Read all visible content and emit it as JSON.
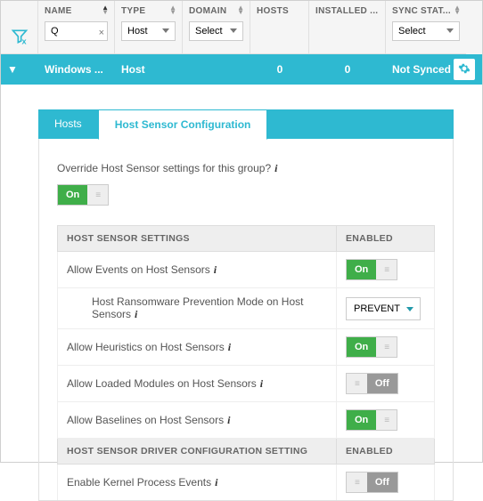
{
  "columns": {
    "name": "NAME",
    "type": "TYPE",
    "domain": "DOMAIN",
    "hosts": "HOSTS",
    "installed": "INSTALLED ...",
    "sync": "SYNC STAT..."
  },
  "filters": {
    "name_value": "Q",
    "type_value": "Host",
    "domain_value": "Select",
    "sync_value": "Select"
  },
  "row": {
    "name": "Windows ...",
    "type": "Host",
    "domain": "",
    "hosts": "0",
    "installed": "0",
    "sync": "Not Synced"
  },
  "tabs": {
    "hosts": "Hosts",
    "config": "Host Sensor Configuration"
  },
  "override_label": "Override Host Sensor settings for this group?",
  "on_label": "On",
  "off_label": "Off",
  "hamburger": "≡",
  "section1": {
    "title": "HOST SENSOR SETTINGS",
    "enabled": "ENABLED"
  },
  "section2": {
    "title": "HOST SENSOR DRIVER CONFIGURATION SETTING",
    "enabled": "ENABLED"
  },
  "settings": {
    "events": "Allow Events on Host Sensors",
    "ransom": "Host Ransomware Prevention Mode on Host Sensors",
    "ransom_value": "PREVENT",
    "heur": "Allow Heuristics on Host Sensors",
    "modules": "Allow Loaded Modules on Host Sensors",
    "baselines": "Allow Baselines on Host Sensors",
    "kernel": "Enable Kernel Process Events"
  }
}
